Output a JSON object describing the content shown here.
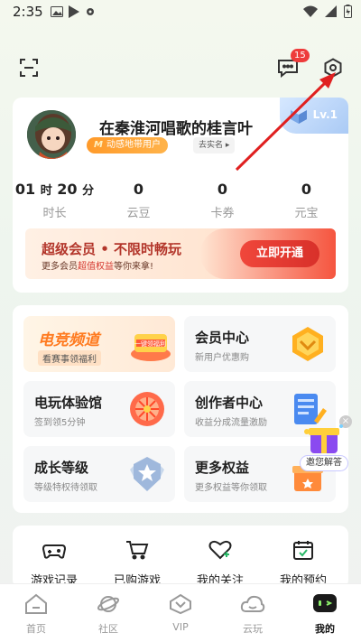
{
  "status_bar": {
    "time": "2:35"
  },
  "header": {
    "message_badge": "15"
  },
  "profile": {
    "username": "在秦淮河唱歌的桂言叶",
    "member_tag": "动感地带用户",
    "member_tag_logo": "M",
    "realname_label": "去实名",
    "level": "Lv.1",
    "stats": [
      {
        "value": "01",
        "unit1": "时",
        "value2": "20",
        "unit2": "分",
        "label": "时长"
      },
      {
        "value": "0",
        "label": "云豆"
      },
      {
        "value": "0",
        "label": "卡券"
      },
      {
        "value": "0",
        "label": "元宝"
      }
    ]
  },
  "vip_banner": {
    "title": "超级会员 • 不限时畅玩",
    "sub_prefix": "更多会员",
    "sub_highlight": "超值权益",
    "sub_suffix": "等你来拿!",
    "button": "立即开通"
  },
  "tiles": [
    {
      "title": "电竞频道",
      "subtitle": "看赛事领福利",
      "badge": "一键领福利"
    },
    {
      "title": "会员中心",
      "subtitle": "新用户优惠购"
    },
    {
      "title": "电玩体验馆",
      "subtitle": "签到领5分钟"
    },
    {
      "title": "创作者中心",
      "subtitle": "收益分成流量激励"
    },
    {
      "title": "成长等级",
      "subtitle": "等级特权待领取"
    },
    {
      "title": "更多权益",
      "subtitle": "更多权益等你领取"
    }
  ],
  "float_help": {
    "label": "邀您解答"
  },
  "quick_actions": [
    {
      "label": "游戏记录"
    },
    {
      "label": "已购游戏"
    },
    {
      "label": "我的关注"
    },
    {
      "label": "我的预约"
    }
  ],
  "tabbar": [
    {
      "label": "首页"
    },
    {
      "label": "社区"
    },
    {
      "label": "VIP"
    },
    {
      "label": "云玩"
    },
    {
      "label": "我的"
    }
  ],
  "colors": {
    "accent": "#e5392f",
    "vip_title": "#b3362b",
    "member_tag": "#ff9a2a"
  }
}
